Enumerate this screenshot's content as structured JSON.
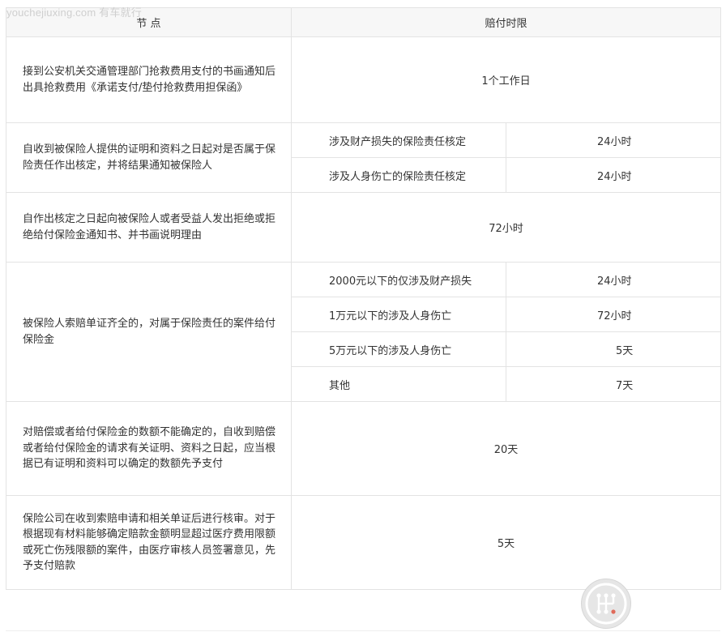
{
  "watermark": "youchejiuxing.com 有车就行",
  "table": {
    "headers": [
      "节 点",
      "赔付时限"
    ],
    "rows": [
      {
        "node": "接到公安机关交通管理部门抢救费用支付的书画通知后出具抢救费用《承诺支付/垫付抢救费用担保函》",
        "limit": "1个工作日"
      },
      {
        "node": "自收到被保险人提供的证明和资料之日起对是否属于保险责任作出核定，并将结果通知被保险人",
        "sub": [
          {
            "condition": "涉及财产损失的保险责任核定",
            "limit": "24小时"
          },
          {
            "condition": "涉及人身伤亡的保险责任核定",
            "limit": "24小时"
          }
        ]
      },
      {
        "node": "自作出核定之日起向被保险人或者受益人发出拒绝或拒绝给付保险金通知书、并书画说明理由",
        "limit": "72小时"
      },
      {
        "node": "被保险人索赔单证齐全的，对属于保险责任的案件给付保险金",
        "sub": [
          {
            "condition": "2000元以下的仅涉及财产损失",
            "limit": "24小时"
          },
          {
            "condition": "1万元以下的涉及人身伤亡",
            "limit": "72小时"
          },
          {
            "condition": "5万元以下的涉及人身伤亡",
            "limit": "5天"
          },
          {
            "condition": "其他",
            "limit": "7天"
          }
        ]
      },
      {
        "node": "对赔偿或者给付保险金的数额不能确定的，自收到赔偿或者给付保险金的请求有关证明、资料之日起，应当根据已有证明和资料可以确定的数额先予支付",
        "limit": "20天"
      },
      {
        "node": "保险公司在收到索赔申请和相关单证后进行核审。对于根据现有材料能够确定赔款金额明显超过医疗费用限额或死亡伤残限额的案件，由医疗审核人员签署意见，先予支付赔款",
        "limit": "5天"
      }
    ]
  }
}
